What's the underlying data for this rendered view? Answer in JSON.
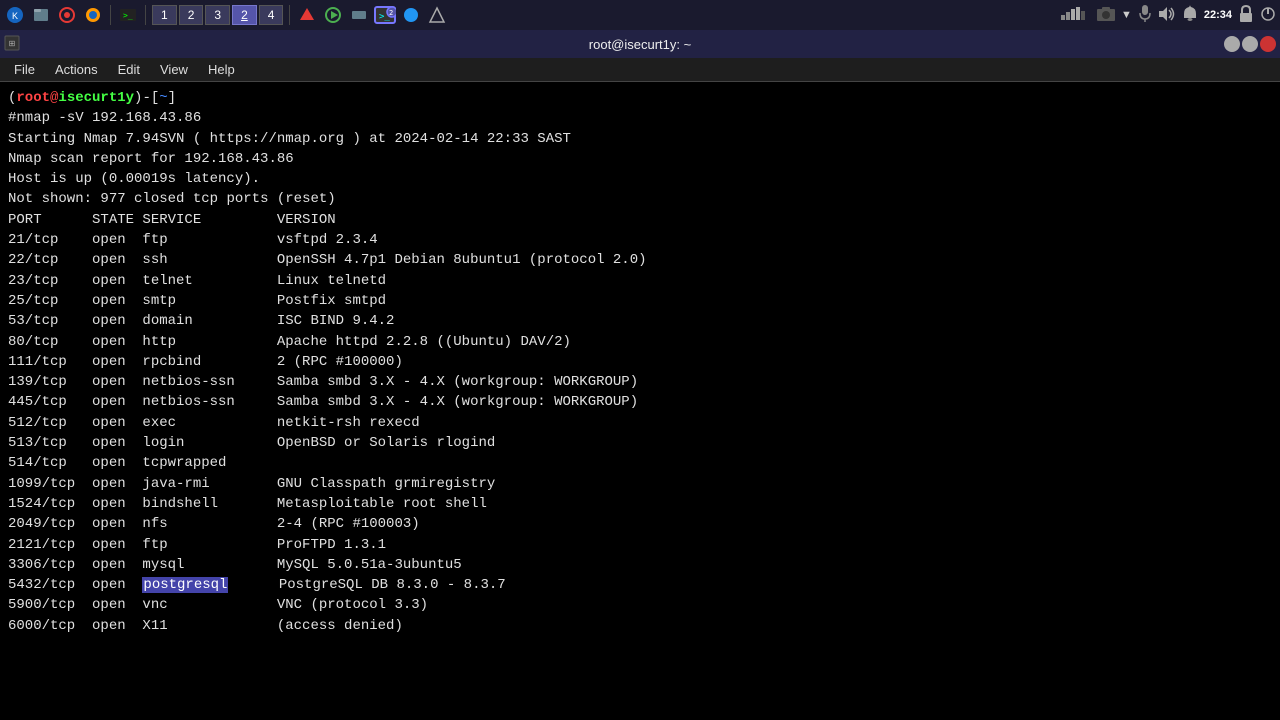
{
  "taskbar": {
    "icons": [
      "kali-icon",
      "files-icon",
      "browser-icon",
      "firefox-icon",
      "terminal-icon"
    ],
    "tabs": [
      {
        "label": "1",
        "active": false
      },
      {
        "label": "2",
        "active": false
      },
      {
        "label": "3",
        "active": false
      },
      {
        "label": "4",
        "active": false
      }
    ],
    "active_terminal": "2",
    "time": "22:34",
    "right_icons": [
      "camera-icon",
      "arrow-icon",
      "mic-icon",
      "volume-icon",
      "bell-icon",
      "lock-icon",
      "settings-icon"
    ]
  },
  "titlebar": {
    "title": "root@isecurt1y: ~"
  },
  "menubar": {
    "items": [
      "File",
      "Actions",
      "Edit",
      "View",
      "Help"
    ]
  },
  "terminal": {
    "prompt": {
      "user": "root",
      "at": "@",
      "host": "isecurt1y",
      "dir": "~"
    },
    "command": "nmap -sV 192.168.43.86",
    "output_lines": [
      "Starting Nmap 7.94SVN ( https://nmap.org ) at 2024-02-14 22:33 SAST",
      "Nmap scan report for 192.168.43.86",
      "Host is up (0.00019s latency).",
      "Not shown: 977 closed tcp ports (reset)",
      "PORT      STATE SERVICE         VERSION",
      "21/tcp    open  ftp             vsftpd 2.3.4",
      "22/tcp    open  ssh             OpenSSH 4.7p1 Debian 8ubuntu1 (protocol 2.0)",
      "23/tcp    open  telnet          Linux telnetd",
      "25/tcp    open  smtp            Postfix smtpd",
      "53/tcp    open  domain          ISC BIND 9.4.2",
      "80/tcp    open  http            Apache httpd 2.2.8 ((Ubuntu) DAV/2)",
      "111/tcp   open  rpcbind         2 (RPC #100000)",
      "139/tcp   open  netbios-ssn     Samba smbd 3.X - 4.X (workgroup: WORKGROUP)",
      "445/tcp   open  netbios-ssn     Samba smbd 3.X - 4.X (workgroup: WORKGROUP)",
      "512/tcp   open  exec            netkit-rsh rexecd",
      "513/tcp   open  login           OpenBSD or Solaris rlogind",
      "514/tcp   open  tcpwrapped",
      "1099/tcp  open  java-rmi        GNU Classpath grmiregistry",
      "1524/tcp  open  bindshell       Metasploitable root shell",
      "2049/tcp  open  nfs             2-4 (RPC #100003)",
      "2121/tcp  open  ftp             ProFTPD 1.3.1",
      "3306/tcp  open  mysql           MySQL 5.0.51a-3ubuntu5",
      "5432/tcp  open  postgresql      PostgreSQL DB 8.3.0 - 8.3.7",
      "5900/tcp  open  vnc             VNC (protocol 3.3)",
      "6000/tcp  open  X11             (access denied)"
    ],
    "highlighted_service": "postgresql"
  }
}
